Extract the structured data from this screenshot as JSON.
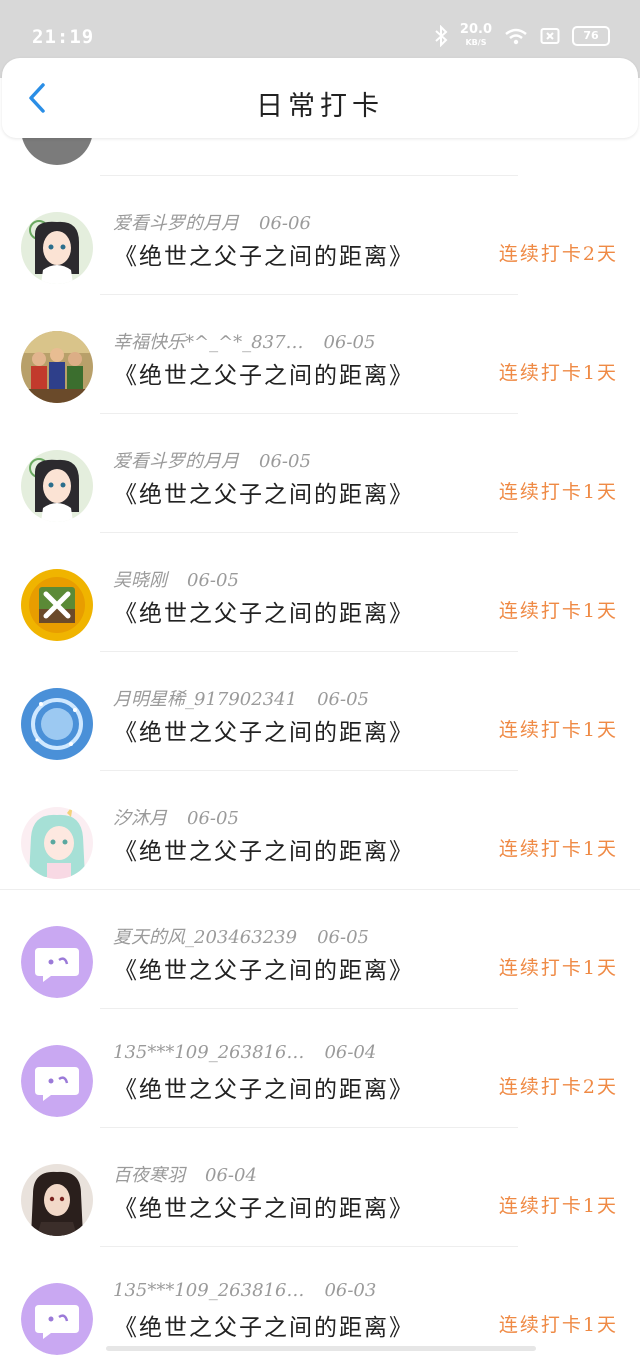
{
  "status_bar": {
    "time": "21:19",
    "net_speed": "20.0",
    "net_unit": "KB/S",
    "battery": "76",
    "icons": [
      "bluetooth-icon",
      "wifi-icon",
      "sim-icon"
    ]
  },
  "header": {
    "title": "日常打卡",
    "back_icon": "chevron-left-icon"
  },
  "colors": {
    "accent": "#2a8ee6",
    "streak": "#ef8a45",
    "placeholder_avatar": "#c9a8f2"
  },
  "rows": [
    {
      "name": "爱看斗罗的月月",
      "date": "06-06",
      "book": "《绝世之父子之间的距离》",
      "streak": "连续打卡2天",
      "avatar": "anime-girl-avatar"
    },
    {
      "name": "幸福快乐*^_^*_837…",
      "date": "06-05",
      "book": "《绝世之父子之间的距离》",
      "streak": "连续打卡1天",
      "avatar": "family-photo-avatar"
    },
    {
      "name": "爱看斗罗的月月",
      "date": "06-05",
      "book": "《绝世之父子之间的距离》",
      "streak": "连续打卡1天",
      "avatar": "anime-girl-avatar"
    },
    {
      "name": "吴晓刚",
      "date": "06-05",
      "book": "《绝世之父子之间的距离》",
      "streak": "连续打卡1天",
      "avatar": "tools-badge-avatar"
    },
    {
      "name": "月明星稀_917902341",
      "date": "06-05",
      "book": "《绝世之父子之间的距离》",
      "streak": "连续打卡1天",
      "avatar": "blue-moon-avatar"
    },
    {
      "name": "汐沐月",
      "date": "06-05",
      "book": "《绝世之父子之间的距离》",
      "streak": "连续打卡1天",
      "avatar": "anime-unicorn-girl-avatar"
    },
    {
      "name": "夏天的风_203463239",
      "date": "06-05",
      "book": "《绝世之父子之间的距离》",
      "streak": "连续打卡1天",
      "avatar": "chat-bubble-avatar"
    },
    {
      "name": "135***109_263816…",
      "date": "06-04",
      "book": "《绝世之父子之间的距离》",
      "streak": "连续打卡2天",
      "avatar": "chat-bubble-avatar"
    },
    {
      "name": "百夜寒羽",
      "date": "06-04",
      "book": "《绝世之父子之间的距离》",
      "streak": "连续打卡1天",
      "avatar": "dark-anime-avatar"
    },
    {
      "name": "135***109_263816…",
      "date": "06-03",
      "book": "《绝世之父子之间的距离》",
      "streak": "连续打卡1天",
      "avatar": "chat-bubble-avatar"
    }
  ]
}
